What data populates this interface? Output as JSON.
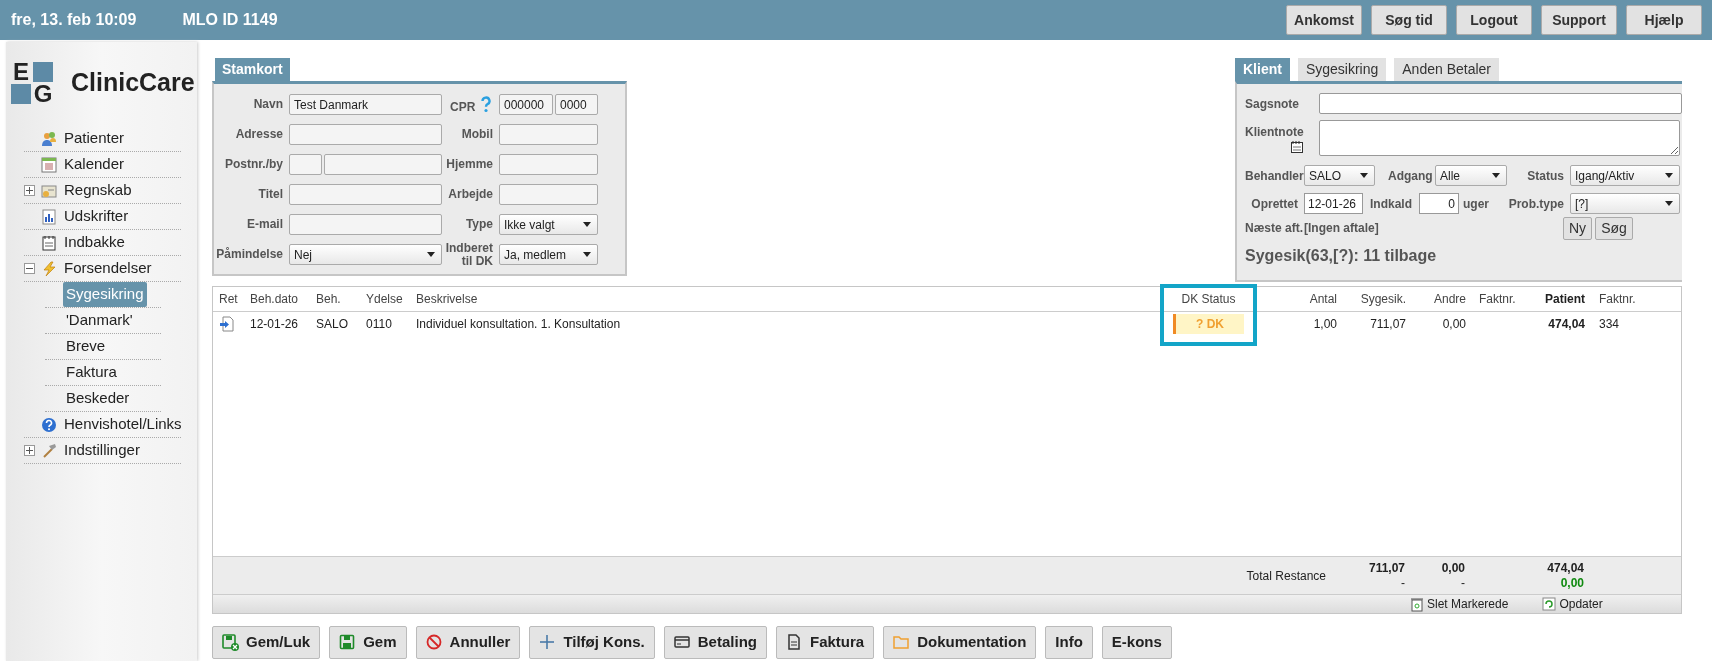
{
  "header": {
    "date": "fre, 13. feb 10:09",
    "id_label": "MLO ID 1149",
    "buttons": [
      "Ankomst",
      "Søg tid",
      "Logout",
      "Support",
      "Hjælp"
    ]
  },
  "sidebar": {
    "logo_letters": [
      "E",
      "G"
    ],
    "logo_text": "ClinicCare",
    "items": [
      {
        "label": "Patienter",
        "kind": "link",
        "selected": false
      },
      {
        "label": "Kalender",
        "kind": "link",
        "selected": false
      },
      {
        "label": "Regnskab",
        "kind": "group",
        "expanded": false,
        "selected": false
      },
      {
        "label": "Udskrifter",
        "kind": "link",
        "selected": false
      },
      {
        "label": "Indbakke",
        "kind": "link",
        "selected": false
      },
      {
        "label": "Forsendelser",
        "kind": "group",
        "expanded": true,
        "selected": false,
        "children": [
          {
            "label": "Sygesikring",
            "selected": true
          },
          {
            "label": "'Danmark'",
            "selected": false
          },
          {
            "label": "Breve",
            "selected": false
          },
          {
            "label": "Faktura",
            "selected": false
          },
          {
            "label": "Beskeder",
            "selected": false
          }
        ]
      },
      {
        "label": "Henvishotel/Links",
        "kind": "link",
        "selected": false
      },
      {
        "label": "Indstillinger",
        "kind": "group",
        "expanded": false,
        "selected": false
      }
    ]
  },
  "stamkort": {
    "tab": "Stamkort",
    "left_fields": [
      {
        "label": "Navn",
        "kind": "text",
        "value": "Test Danmark"
      },
      {
        "label": "Adresse",
        "kind": "text"
      },
      {
        "label": "Postnr./by",
        "kind": "split"
      },
      {
        "label": "Titel",
        "kind": "text"
      },
      {
        "label": "E-mail",
        "kind": "text"
      },
      {
        "label": "Påmindelse",
        "kind": "select",
        "value": "Nej"
      }
    ],
    "right_fields": [
      {
        "label": "CPR",
        "kind": "cpr",
        "values": [
          "000000",
          "0000"
        ]
      },
      {
        "label": "Mobil",
        "kind": "text"
      },
      {
        "label": "Hjemme",
        "kind": "text"
      },
      {
        "label": "Arbejde",
        "kind": "text"
      },
      {
        "label": "Type",
        "kind": "select",
        "value": "Ikke valgt"
      },
      {
        "label": "Indberet til DK",
        "kind": "select",
        "value": "Ja, medlem"
      }
    ]
  },
  "klient": {
    "tabs": [
      {
        "label": "Klient",
        "selected": true
      },
      {
        "label": "Sygesikring",
        "selected": false
      },
      {
        "label": "Anden Betaler",
        "selected": false
      }
    ],
    "sagsnote": {
      "label": "Sagsnote"
    },
    "klientnote": {
      "label": "Klientnote"
    },
    "behandler": {
      "label": "Behandler",
      "value": "SALO"
    },
    "adgang": {
      "label": "Adgang",
      "value": "Alle"
    },
    "status": {
      "label": "Status",
      "value": "Igang/Aktiv"
    },
    "oprettet": {
      "label": "Oprettet",
      "value": "12-01-26"
    },
    "indkald": {
      "label": "Indkald",
      "value": "0",
      "unit": "uger"
    },
    "prob_type": {
      "label": "Prob.type",
      "value": "[?]"
    },
    "naeste_aft": {
      "label": "Næste aft.",
      "value": "[Ingen aftale]"
    },
    "buttons": [
      "Ny",
      "Søg"
    ],
    "summary": "Sygesik(63,[?): 11 tilbage"
  },
  "table": {
    "columns": [
      {
        "label": "Ret",
        "highlighted": false
      },
      {
        "label": "Beh.dato",
        "highlighted": false
      },
      {
        "label": "Beh.",
        "highlighted": false
      },
      {
        "label": "Ydelse",
        "highlighted": false
      },
      {
        "label": "Beskrivelse",
        "highlighted": false
      },
      {
        "label": "DK Status",
        "highlighted": true
      },
      {
        "label": "Antal",
        "highlighted": false
      },
      {
        "label": "Sygesik.",
        "highlighted": false
      },
      {
        "label": "Andre",
        "highlighted": false
      },
      {
        "label": "Faktnr.",
        "highlighted": false
      },
      {
        "label": "Patient",
        "highlighted": false
      },
      {
        "label": "Faktnr.",
        "highlighted": false
      }
    ],
    "rows": [
      {
        "beh_dato": "12-01-26",
        "beh": "SALO",
        "ydelse": "0110",
        "beskrivelse": "Individuel konsultation. 1. Konsultation",
        "dk_status": "? DK",
        "antal": "1,00",
        "sygesik": "711,07",
        "andre": "0,00",
        "patient": "474,04",
        "faktnr_2": "334"
      }
    ],
    "totals": {
      "label": "Total Restance",
      "sygesik": [
        "711,07",
        "-"
      ],
      "andre": [
        "0,00",
        "-"
      ],
      "patient": [
        "474,04",
        "0,00"
      ]
    },
    "actions": [
      "Slet Markerede",
      "Opdater"
    ]
  },
  "buttons": [
    "Gem/Luk",
    "Gem",
    "Annuller",
    "Tilføj Kons.",
    "Betaling",
    "Faktura",
    "Dokumentation",
    "Info",
    "E-kons"
  ]
}
